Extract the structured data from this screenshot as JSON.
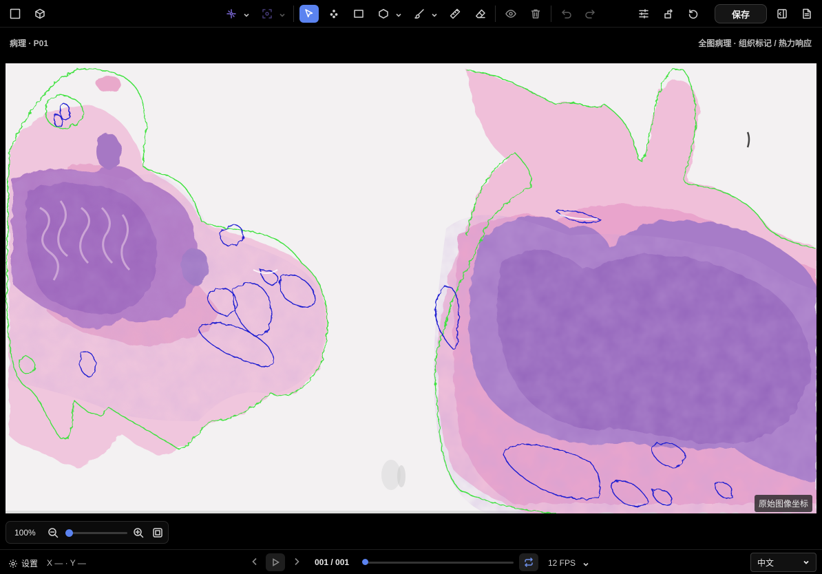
{
  "toolbar": {
    "save_label": "保存",
    "tools": [
      {
        "name": "layout-square-icon"
      },
      {
        "name": "cube-icon"
      },
      {
        "name": "ai-sparkle-icon"
      },
      {
        "name": "ai-scan-icon"
      },
      {
        "name": "select-pointer-icon",
        "active": true
      },
      {
        "name": "point-tool-icon"
      },
      {
        "name": "rectangle-tool-icon"
      },
      {
        "name": "polygon-tool-icon"
      },
      {
        "name": "brush-tool-icon"
      },
      {
        "name": "ruler-tool-icon"
      },
      {
        "name": "eraser-tool-icon"
      },
      {
        "name": "eye-icon"
      },
      {
        "name": "trash-icon"
      },
      {
        "name": "undo-icon"
      },
      {
        "name": "redo-icon"
      },
      {
        "name": "sliders-icon"
      },
      {
        "name": "share-icon"
      },
      {
        "name": "refresh-icon"
      },
      {
        "name": "sidebar-toggle-icon"
      },
      {
        "name": "document-icon"
      }
    ]
  },
  "subheader": {
    "left": "病理 · P01",
    "right": "全图病理 · 组织标记 / 热力响应"
  },
  "canvas": {
    "coord_label": "原始图像坐标",
    "colors": {
      "outline": "#3ee23e",
      "annotation": "#1a1ad0",
      "tissue_pink": "#e9a8cf",
      "tissue_purple": "#a479c6"
    }
  },
  "zoom": {
    "percent": "100%",
    "level": 0.0
  },
  "bottom": {
    "settings_label": "设置",
    "coords": "X — · Y —",
    "frame": "001 / 001",
    "timeline_position": 0.0,
    "fps": "12 FPS",
    "language": "中文"
  }
}
